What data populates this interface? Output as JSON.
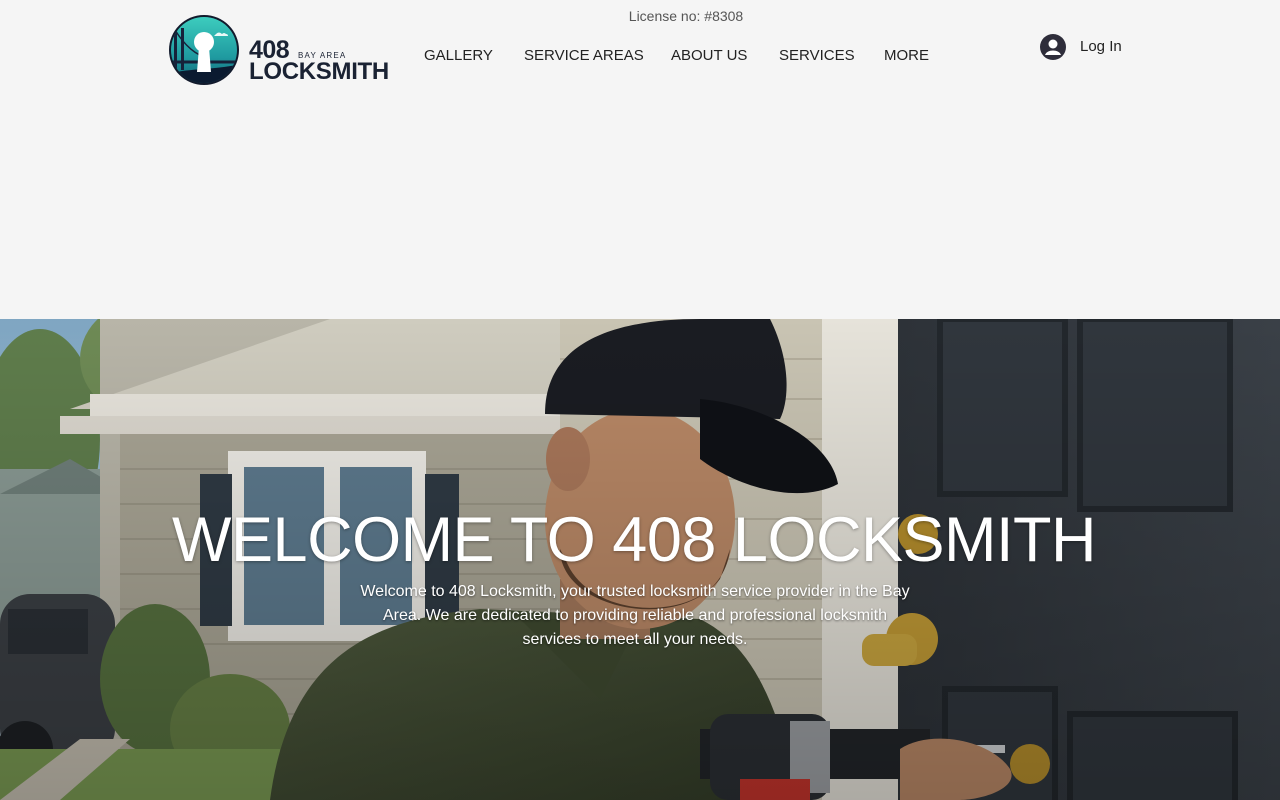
{
  "header": {
    "license": "License no: #8308",
    "logo": {
      "number": "408",
      "area": "BAY AREA",
      "word": "LOCKSMITH"
    },
    "nav": [
      "GALLERY",
      "SERVICE AREAS",
      "ABOUT US",
      "SERVICES",
      "MORE"
    ],
    "login": {
      "label": "Log In",
      "icon": "user-avatar-icon"
    }
  },
  "hero": {
    "title": "WELCOME TO 408 LOCKSMITH",
    "text": "Welcome to 408 Locksmith, your trusted locksmith service provider in the Bay Area. We are dedicated to providing reliable and professional locksmith services to meet all your needs."
  },
  "colors": {
    "background": "#f5f5f5",
    "text": "#222222",
    "logo_dark": "#1a2233",
    "logo_teal": "#2bb5a9",
    "hero_text": "#ffffff"
  }
}
